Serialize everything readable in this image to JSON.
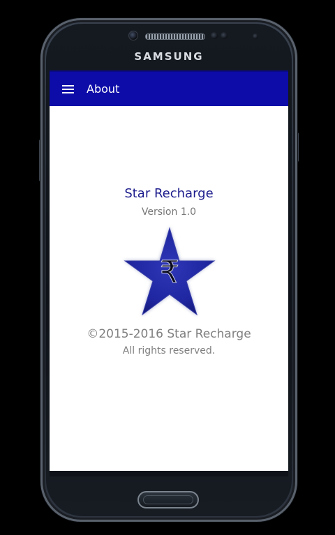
{
  "device": {
    "brand": "SAMSUNG"
  },
  "appbar": {
    "menu_icon": "hamburger-menu-icon",
    "title": "About",
    "color": "#0d0ca8"
  },
  "about": {
    "app_name": "Star Recharge",
    "version": "Version 1.0",
    "logo_icon": "blue-star-rupee-logo",
    "logo_glyph": "₹",
    "copyright": "©2015-2016 Star Recharge",
    "rights": "All rights reserved."
  }
}
